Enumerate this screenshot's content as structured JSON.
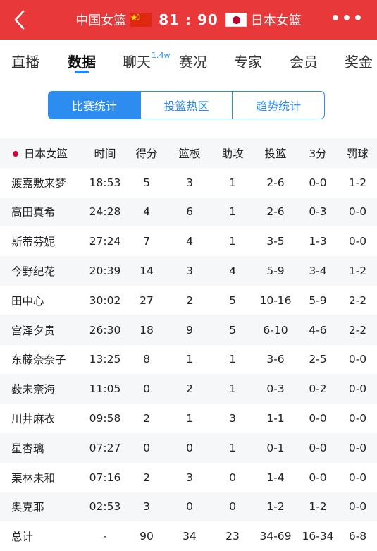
{
  "header": {
    "home_team": "中国女篮",
    "score": "81 : 90",
    "away_team": "日本女篮"
  },
  "tabs": [
    {
      "label": "直播"
    },
    {
      "label": "数据"
    },
    {
      "label": "聊天",
      "badge": "1.4w"
    },
    {
      "label": "赛况"
    },
    {
      "label": "专家"
    },
    {
      "label": "会员"
    },
    {
      "label": "奖金"
    }
  ],
  "segments": [
    "比赛统计",
    "投篮热区",
    "趋势统计"
  ],
  "table": {
    "team": "日本女篮",
    "columns": [
      "时间",
      "得分",
      "篮板",
      "助攻",
      "投篮",
      "3分",
      "罚球"
    ],
    "rows": [
      [
        "渡嘉敷来梦",
        "18:53",
        "5",
        "3",
        "1",
        "2-6",
        "0-0",
        "1-2"
      ],
      [
        "高田真希",
        "24:28",
        "4",
        "6",
        "1",
        "2-6",
        "0-3",
        "0-0"
      ],
      [
        "斯蒂芬妮",
        "27:24",
        "7",
        "4",
        "1",
        "3-5",
        "1-3",
        "0-0"
      ],
      [
        "今野纪花",
        "20:39",
        "14",
        "3",
        "4",
        "5-9",
        "3-4",
        "1-2"
      ],
      [
        "田中心",
        "30:02",
        "27",
        "2",
        "5",
        "10-16",
        "5-9",
        "2-2"
      ],
      [
        "宫泽夕贵",
        "26:30",
        "18",
        "9",
        "5",
        "6-10",
        "4-6",
        "2-2"
      ],
      [
        "东藤奈奈子",
        "13:25",
        "8",
        "1",
        "1",
        "3-6",
        "2-5",
        "0-0"
      ],
      [
        "薮未奈海",
        "11:05",
        "0",
        "2",
        "1",
        "0-3",
        "0-2",
        "0-0"
      ],
      [
        "川井麻衣",
        "09:58",
        "2",
        "1",
        "3",
        "1-1",
        "0-0",
        "0-0"
      ],
      [
        "星杏璃",
        "07:27",
        "0",
        "0",
        "1",
        "0-1",
        "0-0",
        "0-0"
      ],
      [
        "栗林未和",
        "07:16",
        "2",
        "3",
        "0",
        "1-4",
        "0-0",
        "0-0"
      ],
      [
        "奥克耶",
        "02:53",
        "3",
        "0",
        "0",
        "1-2",
        "1-2",
        "0-0"
      ],
      [
        "总计",
        "-",
        "90",
        "34",
        "23",
        "34-69",
        "16-34",
        "6-8"
      ]
    ]
  }
}
